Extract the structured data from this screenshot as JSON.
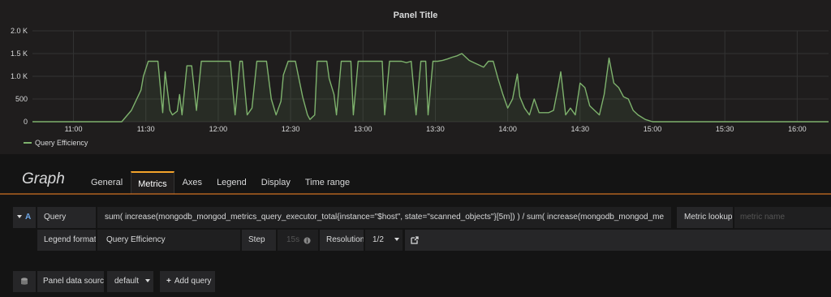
{
  "panel": {
    "title": "Panel Title",
    "legend": "Query Efficiency"
  },
  "chart_data": {
    "type": "line",
    "title": "Panel Title",
    "xlabel": "",
    "ylabel": "",
    "ylim": [
      0,
      2000
    ],
    "yticks": [
      "0",
      "500",
      "1.0 K",
      "1.5 K",
      "2.0 K"
    ],
    "xticks": [
      "11:00",
      "11:30",
      "12:00",
      "12:30",
      "13:00",
      "13:30",
      "14:00",
      "14:30",
      "15:00",
      "15:30",
      "16:00"
    ],
    "x_range": [
      "10:43",
      "16:13"
    ],
    "grid": true,
    "line_color": "#7eb26d",
    "series": [
      {
        "name": "Query Efficiency",
        "x": [
          "10:43",
          "11:20",
          "11:24",
          "11:28",
          "11:29",
          "11:31",
          "11:33",
          "11:35",
          "11:37",
          "11:38",
          "11:40",
          "11:41",
          "11:43",
          "11:44",
          "11:45",
          "11:47",
          "11:49",
          "11:51",
          "11:53",
          "11:54",
          "11:56",
          "11:58",
          "11:59",
          "12:01",
          "12:03",
          "12:05",
          "12:07",
          "12:09",
          "12:10",
          "12:12",
          "12:14",
          "12:16",
          "12:17",
          "12:19",
          "12:20",
          "12:22",
          "12:24",
          "12:26",
          "12:27",
          "12:29",
          "12:30",
          "12:32",
          "12:35",
          "12:37",
          "12:38",
          "12:40",
          "12:41",
          "12:43",
          "12:45",
          "12:46",
          "12:48",
          "12:49",
          "12:51",
          "12:53",
          "12:55",
          "12:56",
          "12:58",
          "13:00",
          "13:02",
          "13:04",
          "13:06",
          "13:08",
          "13:09",
          "13:11",
          "13:13",
          "13:15",
          "13:16",
          "13:18",
          "13:20",
          "13:22",
          "13:24",
          "13:26",
          "13:27",
          "13:29",
          "13:31",
          "13:33",
          "13:35",
          "13:37",
          "13:39",
          "13:41",
          "13:42",
          "13:44",
          "13:46",
          "13:48",
          "13:50",
          "13:52",
          "13:54",
          "13:56",
          "13:58",
          "14:00",
          "14:02",
          "14:04",
          "14:05",
          "14:07",
          "14:09",
          "14:11",
          "14:13",
          "14:15",
          "14:17",
          "14:19",
          "14:21",
          "14:22",
          "14:24",
          "14:26",
          "14:28",
          "14:30",
          "14:32",
          "14:34",
          "14:36",
          "14:38",
          "14:40",
          "14:42",
          "14:44",
          "14:46",
          "14:48",
          "14:50",
          "14:52",
          "14:54",
          "14:57",
          "15:00",
          "16:13"
        ],
        "values": [
          0,
          0,
          250,
          700,
          1000,
          1330,
          1330,
          1330,
          200,
          1100,
          250,
          150,
          230,
          600,
          150,
          1230,
          1230,
          250,
          1330,
          1330,
          1330,
          1330,
          1330,
          1330,
          1330,
          1330,
          150,
          1330,
          1330,
          150,
          300,
          1330,
          1330,
          1330,
          1330,
          500,
          150,
          450,
          1030,
          1330,
          1330,
          1330,
          550,
          150,
          50,
          150,
          1330,
          1330,
          1330,
          950,
          600,
          150,
          1330,
          1330,
          1330,
          150,
          1330,
          1330,
          1330,
          1330,
          1330,
          1330,
          150,
          1330,
          1330,
          1330,
          1330,
          1300,
          1330,
          150,
          1330,
          1330,
          150,
          1330,
          1330,
          1350,
          1380,
          1420,
          1450,
          1500,
          1450,
          1350,
          1300,
          1250,
          1200,
          1330,
          1330,
          950,
          600,
          300,
          500,
          1050,
          550,
          300,
          150,
          500,
          200,
          200,
          200,
          250,
          800,
          1100,
          150,
          300,
          150,
          850,
          750,
          350,
          250,
          150,
          600,
          1400,
          850,
          750,
          550,
          500,
          250,
          150,
          50,
          0,
          0
        ]
      }
    ]
  },
  "editor": {
    "title": "Graph",
    "tabs": [
      "General",
      "Metrics",
      "Axes",
      "Legend",
      "Display",
      "Time range"
    ],
    "active_tab": "Metrics"
  },
  "query": {
    "ref_id": "A",
    "query_label": "Query",
    "query_value": "sum(      increase(mongodb_mongod_metrics_query_executor_total{instance=\"$host\", state=\"scanned_objects\"}[5m]) ) / sum(      increase(mongodb_mongod_me",
    "metric_lookup_label": "Metric lookup",
    "metric_lookup_placeholder": "metric name",
    "legend_format_label": "Legend format",
    "legend_format_value": "Query Efficiency",
    "step_label": "Step",
    "step_placeholder": "15s",
    "resolution_label": "Resolution",
    "resolution_value": "1/2"
  },
  "footer": {
    "datasource_label": "Panel data source",
    "datasource_value": "default",
    "add_query_label": "Add query"
  },
  "colors": {
    "series": "#7eb26d",
    "active_tab_accent": "#f4a32a",
    "ref_id": "#6ea6e6"
  },
  "icons": {
    "step_info": "info-icon",
    "resolution_link": "external-link-icon",
    "datasource": "database-icon",
    "add_query": "plus-icon",
    "collapse": "caret-down-icon"
  }
}
